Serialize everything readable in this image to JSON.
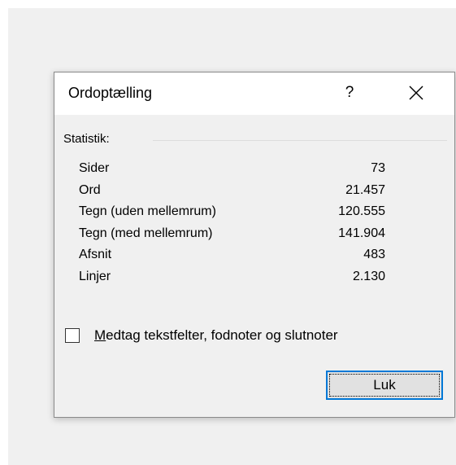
{
  "dialog": {
    "title": "Ordoptælling",
    "help_label": "?",
    "close_icon": "close-icon"
  },
  "statistics": {
    "heading": "Statistik:",
    "rows": [
      {
        "label": "Sider",
        "value": "73"
      },
      {
        "label": "Ord",
        "value": "21.457"
      },
      {
        "label": "Tegn (uden mellemrum)",
        "value": "120.555"
      },
      {
        "label": "Tegn (med mellemrum)",
        "value": "141.904"
      },
      {
        "label": "Afsnit",
        "value": "483"
      },
      {
        "label": "Linjer",
        "value": "2.130"
      }
    ]
  },
  "include_option": {
    "mnemonic": "M",
    "label_rest": "edtag tekstfelter, fodnoter og slutnoter",
    "checked": false
  },
  "buttons": {
    "close_label": "Luk"
  },
  "colors": {
    "focus_border": "#0078d7",
    "dialog_bg": "#f0f0f0",
    "titlebar_bg": "#ffffff"
  }
}
